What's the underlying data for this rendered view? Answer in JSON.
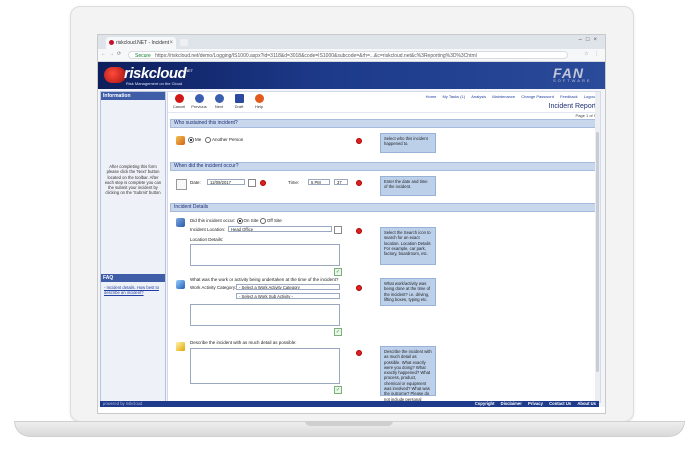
{
  "browser": {
    "tab_title": "riskcloud.NET - Incident",
    "url_secure": "Secure",
    "url": "https://riskcloud.net/demo/Logging/IS1000.aspx?id=3118&d=3018&code=IS1000&subcode=&rh=...&c=riskcloud.net&c%3Reporting%3D%3Chtml"
  },
  "header": {
    "logo_text": "riskcloud",
    "logo_net": ".NET",
    "tagline": "Risk Management on the Cloud",
    "brand2_mark": "FAN",
    "brand2_sub": "SOFTWARE"
  },
  "sidebar": {
    "title": "Information",
    "info_text": "After completing this form please click the 'Next' button located on the toolbar. After each step is complete you can the submit your incident by clicking on the 'Submit' button",
    "faq_title": "FAQ",
    "faq_link": "- Incident details. How best to describe an incident?"
  },
  "toolbar": {
    "buttons": [
      {
        "label": "Cancel",
        "icon": "cancel-icon",
        "color": "#d01818"
      },
      {
        "label": "Previous",
        "icon": "previous-icon",
        "color": "#3a5fb0"
      },
      {
        "label": "Next",
        "icon": "next-icon",
        "color": "#3a5fb0"
      },
      {
        "label": "Draft",
        "icon": "save-icon",
        "color": "#2a4aa0"
      },
      {
        "label": "Help",
        "icon": "help-icon",
        "color": "#e25a1c"
      }
    ],
    "links": [
      "Home",
      "My Tasks (1)",
      "Analysis",
      "Maintenance",
      "Change Password",
      "Feedback",
      "Logout"
    ],
    "report_title": "Incident Report",
    "page_label": "Page 1 of 5"
  },
  "sections": {
    "who": {
      "header": "Who sustained this incident?",
      "opt_me": "Me",
      "opt_other": "Another Person",
      "help": "Select who this incident happened to."
    },
    "when": {
      "header": "When did the incident occur?",
      "date_label": "Date:",
      "date_value": "12/09/2017",
      "time_label": "Time:",
      "time_hour": "5 PM",
      "time_min": "37",
      "help": "Enter the date and time of the incident."
    },
    "details": {
      "header": "Incident Details",
      "occur_q": "Did this incident occur:",
      "opt_onsite": "On Site",
      "opt_offsite": "Off Site",
      "location_label": "Incident Location:",
      "location_value": "Head Office",
      "location_details_label": "Location Details:",
      "location_help": "Select the Search icon to search for an exact location. Location Details For example, car park, factory, boardroom, etc.",
      "work_q": "What was the work or activity being undertaken at the time of the incident?",
      "work_cat_label": "Work Activity Category:",
      "work_cat_value": "- Select a Work Activity Category",
      "work_sub_value": "- Select a Work Sub Activity -",
      "work_help": "What work/activity was being done at the time of the incident? i.e. driving, lifting boxes, typing etc.",
      "describe_q": "Describe the incident with as much detail as possible:",
      "describe_help": "Describe the incident with as much detail as possible. What exactly were you doing? What exactly happened? What process, product, chemical or equipment was involved? What was the outcome? Please do not include personal information unless required."
    }
  },
  "footer": {
    "left": "powered by riskcloud",
    "links": [
      "Copyright",
      "Disclaimer",
      "Privacy",
      "Contact Us",
      "About Us"
    ]
  }
}
